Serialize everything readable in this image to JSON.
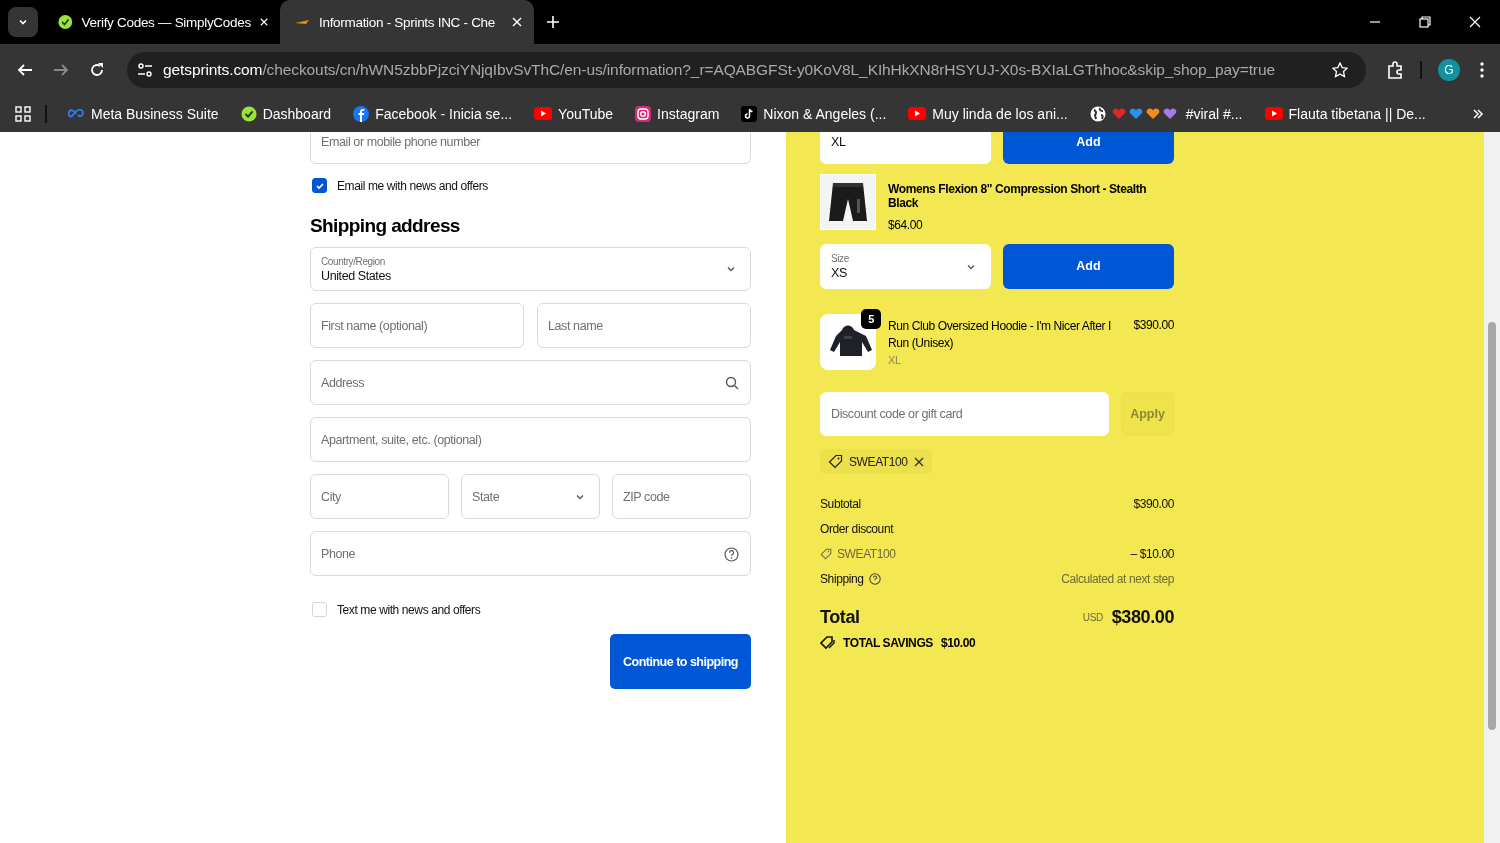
{
  "browser": {
    "tabs": [
      {
        "title": "Verify Codes — SimplyCodes",
        "kind": "simply",
        "selected": false
      },
      {
        "title": "Information - Sprints INC - Che",
        "kind": "sprints",
        "selected": true
      }
    ],
    "url": {
      "domain": "getsprints.com",
      "path": "/checkouts/cn/hWN5zbbPjzciYNjqIbvSvThC/en-us/information?_r=AQABGFSt-y0KoV8L_KIhHkXN8rHSYUJ-X0s-BXIaLGThhoc&skip_shop_pay=true"
    },
    "profile_initial": "G",
    "bookmarks": [
      {
        "label": "Meta Business Suite",
        "kind": "meta"
      },
      {
        "label": "Dashboard",
        "kind": "simply"
      },
      {
        "label": "Facebook - Inicia se...",
        "kind": "facebook"
      },
      {
        "label": "YouTube",
        "kind": "youtube"
      },
      {
        "label": "Instagram",
        "kind": "instagram"
      },
      {
        "label": "Nixon & Angeles (...",
        "kind": "tiktok"
      },
      {
        "label": "Muy linda de los ani...",
        "kind": "youtube"
      },
      {
        "label": "#viral #...",
        "kind": "globe-hearts"
      },
      {
        "label": "Flauta tibetana || De...",
        "kind": "youtube"
      }
    ]
  },
  "contact": {
    "placeholder": "Email or mobile phone number",
    "news": {
      "label": "Email me with news and offers",
      "checked": true
    }
  },
  "shipping": {
    "heading": "Shipping address",
    "country": {
      "label": "Country/Region",
      "value": "United States"
    },
    "first_name": {
      "placeholder": "First name (optional)"
    },
    "last_name": {
      "placeholder": "Last name"
    },
    "address": {
      "placeholder": "Address"
    },
    "apartment": {
      "placeholder": "Apartment, suite, etc. (optional)"
    },
    "city": {
      "placeholder": "City"
    },
    "state": {
      "placeholder": "State"
    },
    "zip": {
      "placeholder": "ZIP code"
    },
    "phone": {
      "placeholder": "Phone"
    },
    "text_news": {
      "label": "Text me with news and offers",
      "checked": false
    },
    "continue_button": "Continue to shipping"
  },
  "summary": {
    "previous_upsell": {
      "size_value": "XL",
      "button": "Add"
    },
    "upsell": {
      "name": "Womens Flexion 8\" Compression Short - Stealth Black",
      "price": "$64.00",
      "size_label": "Size",
      "size_value": "XS",
      "button": "Add"
    },
    "line_items": [
      {
        "name": "Run Club Oversized Hoodie - I'm Nicer After I Run (Unisex)",
        "variant": "XL",
        "price": "$390.00",
        "quantity": "5"
      }
    ],
    "discount": {
      "placeholder": "Discount code or gift card",
      "button": "Apply"
    },
    "applied_codes": [
      {
        "code": "SWEAT100"
      }
    ],
    "subtotal": {
      "label": "Subtotal",
      "value": "$390.00"
    },
    "order_discount": {
      "label": "Order discount",
      "code": "SWEAT100",
      "value": "– $10.00"
    },
    "shipping": {
      "label": "Shipping",
      "value": "Calculated at next step"
    },
    "total": {
      "label": "Total",
      "currency": "USD",
      "value": "$380.00"
    },
    "savings": {
      "label": "TOTAL SAVINGS",
      "value": "$10.00"
    }
  }
}
